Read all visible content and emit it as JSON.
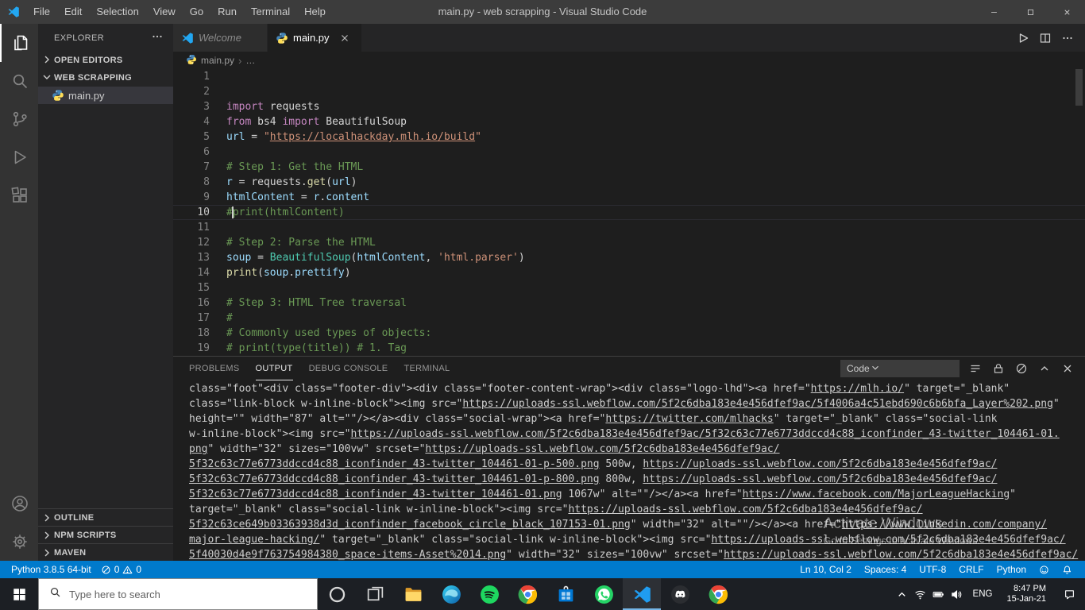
{
  "title_bar": {
    "logo_icon": "vscode-logo-icon",
    "menus": [
      "File",
      "Edit",
      "Selection",
      "View",
      "Go",
      "Run",
      "Terminal",
      "Help"
    ],
    "title": "main.py - web scrapping - Visual Studio Code",
    "window_controls": [
      "minimize-icon",
      "maximize-icon",
      "close-icon"
    ]
  },
  "activity_bar": {
    "top": [
      {
        "icon": "files-icon",
        "active": true
      },
      {
        "icon": "search-icon"
      },
      {
        "icon": "source-control-icon"
      },
      {
        "icon": "run-debug-icon"
      },
      {
        "icon": "extensions-icon"
      }
    ],
    "bottom": [
      {
        "icon": "account-icon"
      },
      {
        "icon": "settings-gear-icon"
      }
    ]
  },
  "sidebar": {
    "title": "EXPLORER",
    "actions_icon": "more-icon",
    "open_editors_label": "OPEN EDITORS",
    "open_editors_chevron": "chevron-right-icon",
    "folder_label": "WEB SCRAPPING",
    "folder_chevron": "chevron-down-icon",
    "files": [
      {
        "name": "main.py",
        "icon": "python-icon",
        "selected": true
      }
    ],
    "bottom_sections": [
      "OUTLINE",
      "NPM SCRIPTS",
      "MAVEN"
    ]
  },
  "editor": {
    "tabs": [
      {
        "label": "Welcome",
        "icon": "vscode-logo-icon",
        "active": false,
        "italic": true,
        "closable": false
      },
      {
        "label": "main.py",
        "icon": "python-icon",
        "active": true,
        "italic": false,
        "closable": true
      }
    ],
    "actions": [
      "play-icon",
      "split-editor-icon",
      "more-icon"
    ],
    "breadcrumb": {
      "icon": "python-icon",
      "file": "main.py",
      "separator": "›",
      "more": "…"
    },
    "lines": [
      {
        "n": 1,
        "segs": []
      },
      {
        "n": 2,
        "segs": []
      },
      {
        "n": 3,
        "segs": [
          [
            "k",
            "import"
          ],
          [
            "d",
            " requests"
          ]
        ]
      },
      {
        "n": 4,
        "segs": [
          [
            "k",
            "from"
          ],
          [
            "d",
            " bs4 "
          ],
          [
            "k",
            "import"
          ],
          [
            "d",
            " BeautifulSoup"
          ]
        ]
      },
      {
        "n": 5,
        "segs": [
          [
            "v",
            "url"
          ],
          [
            "d",
            " = "
          ],
          [
            "s",
            "\""
          ],
          [
            "su",
            "https://localhackday.mlh.io/build"
          ],
          [
            "s",
            "\""
          ]
        ]
      },
      {
        "n": 6,
        "segs": []
      },
      {
        "n": 7,
        "segs": [
          [
            "c",
            "# Step 1: Get the HTML"
          ]
        ]
      },
      {
        "n": 8,
        "segs": [
          [
            "v",
            "r"
          ],
          [
            "d",
            " = "
          ],
          [
            "d",
            "requests."
          ],
          [
            "f",
            "get"
          ],
          [
            "d",
            "("
          ],
          [
            "v",
            "url"
          ],
          [
            "d",
            ")"
          ]
        ]
      },
      {
        "n": 9,
        "segs": [
          [
            "v",
            "htmlContent"
          ],
          [
            "d",
            " = "
          ],
          [
            "v",
            "r"
          ],
          [
            "d",
            "."
          ],
          [
            "v",
            "content"
          ]
        ]
      },
      {
        "n": 10,
        "current": true,
        "segs": [
          [
            "c",
            "#"
          ],
          [
            "cursor",
            ""
          ],
          [
            "c",
            "print(htmlContent)"
          ]
        ]
      },
      {
        "n": 11,
        "segs": []
      },
      {
        "n": 12,
        "segs": [
          [
            "c",
            "# Step 2: Parse the HTML"
          ]
        ]
      },
      {
        "n": 13,
        "segs": [
          [
            "v",
            "soup"
          ],
          [
            "d",
            " = "
          ],
          [
            "t",
            "BeautifulSoup"
          ],
          [
            "d",
            "("
          ],
          [
            "v",
            "htmlContent"
          ],
          [
            "d",
            ", "
          ],
          [
            "s",
            "'html.parser'"
          ],
          [
            "d",
            ")"
          ]
        ]
      },
      {
        "n": 14,
        "segs": [
          [
            "f",
            "print"
          ],
          [
            "d",
            "("
          ],
          [
            "v",
            "soup"
          ],
          [
            "d",
            "."
          ],
          [
            "v",
            "prettify"
          ],
          [
            "d",
            ")"
          ]
        ]
      },
      {
        "n": 15,
        "segs": []
      },
      {
        "n": 16,
        "segs": [
          [
            "c",
            "# Step 3: HTML Tree traversal"
          ]
        ]
      },
      {
        "n": 17,
        "segs": [
          [
            "c",
            "#"
          ]
        ]
      },
      {
        "n": 18,
        "segs": [
          [
            "c",
            "# Commonly used types of objects:"
          ]
        ]
      },
      {
        "n": 19,
        "segs": [
          [
            "c",
            "# print(type(title)) # 1. Tag"
          ]
        ]
      }
    ]
  },
  "panel": {
    "tabs": [
      {
        "label": "PROBLEMS"
      },
      {
        "label": "OUTPUT",
        "active": true
      },
      {
        "label": "DEBUG CONSOLE"
      },
      {
        "label": "TERMINAL"
      }
    ],
    "channel": "Code",
    "channel_chevron": "chevron-down-icon",
    "actions": [
      "word-wrap-icon",
      "lock-icon",
      "clear-output-icon",
      "chevron-up-icon",
      "close-icon"
    ],
    "output_lines": [
      [
        [
          "d",
          "class=\"foot\"<div class=\"footer-div\"><div class=\"footer-content-wrap\"><div class=\"logo-lhd\"><a href=\""
        ],
        [
          "u",
          "https://mlh.io/"
        ],
        [
          "d",
          "\" target=\"_blank\""
        ]
      ],
      [
        [
          "d",
          "class=\"link-block w-inline-block\"><img src=\""
        ],
        [
          "u",
          "https://uploads-ssl.webflow.com/5f2c6dba183e4e456dfef9ac/5f4006a4c51ebd690c6b6bfa_Layer%202.png"
        ],
        [
          "d",
          "\""
        ]
      ],
      [
        [
          "d",
          "height=\"\" width=\"87\" alt=\"\"/></a><div class=\"social-wrap\"><a href=\""
        ],
        [
          "u",
          "https://twitter.com/mlhacks"
        ],
        [
          "d",
          "\" target=\"_blank\" class=\"social-link"
        ]
      ],
      [
        [
          "d",
          "w-inline-block\"><img src=\""
        ],
        [
          "u",
          "https://uploads-ssl.webflow.com/5f2c6dba183e4e456dfef9ac/5f32c63c77e6773ddccd4c88_iconfinder_43-twitter_104461-01."
        ]
      ],
      [
        [
          "u",
          "png"
        ],
        [
          "d",
          "\" width=\"32\" sizes=\"100vw\" srcset=\""
        ],
        [
          "u",
          "https://uploads-ssl.webflow.com/5f2c6dba183e4e456dfef9ac/"
        ]
      ],
      [
        [
          "u",
          "5f32c63c77e6773ddccd4c88_iconfinder_43-twitter_104461-01-p-500.png"
        ],
        [
          "d",
          " 500w, "
        ],
        [
          "u",
          "https://uploads-ssl.webflow.com/5f2c6dba183e4e456dfef9ac/"
        ]
      ],
      [
        [
          "u",
          "5f32c63c77e6773ddccd4c88_iconfinder_43-twitter_104461-01-p-800.png"
        ],
        [
          "d",
          " 800w, "
        ],
        [
          "u",
          "https://uploads-ssl.webflow.com/5f2c6dba183e4e456dfef9ac/"
        ]
      ],
      [
        [
          "u",
          "5f32c63c77e6773ddccd4c88_iconfinder_43-twitter_104461-01.png"
        ],
        [
          "d",
          " 1067w\" alt=\"\"/></a><a href=\""
        ],
        [
          "u",
          "https://www.facebook.com/MajorLeagueHacking"
        ],
        [
          "d",
          "\""
        ]
      ],
      [
        [
          "d",
          "target=\"_blank\" class=\"social-link w-inline-block\"><img src=\""
        ],
        [
          "u",
          "https://uploads-ssl.webflow.com/5f2c6dba183e4e456dfef9ac/"
        ]
      ],
      [
        [
          "u",
          "5f32c63ce649b03363938d3d_iconfinder_facebook_circle_black_107153-01.png"
        ],
        [
          "d",
          "\" width=\"32\" alt=\"\"/></a><a href=\""
        ],
        [
          "u",
          "https://www.linkedin.com/company/"
        ]
      ],
      [
        [
          "u",
          "major-league-hacking/"
        ],
        [
          "d",
          "\" target=\"_blank\" class=\"social-link w-inline-block\"><img src=\""
        ],
        [
          "u",
          "https://uploads-ssl.webflow.com/5f2c6dba183e4e456dfef9ac/"
        ]
      ],
      [
        [
          "u",
          "5f40030d4e9f763754984380_space-items-Asset%2014.png"
        ],
        [
          "d",
          "\" width=\"32\" sizes=\"100vw\" srcset=\""
        ],
        [
          "u",
          "https://uploads-ssl.webflow.com/5f2c6dba183e4e456dfef9ac/"
        ]
      ]
    ]
  },
  "status_bar": {
    "interpreter": "Python 3.8.5 64-bit",
    "errors": "0",
    "warnings": "0",
    "right": [
      {
        "label": "Ln 10, Col 2"
      },
      {
        "label": "Spaces: 4"
      },
      {
        "label": "UTF-8"
      },
      {
        "label": "CRLF"
      },
      {
        "label": "Python"
      },
      {
        "icon": "feedback-smiley-icon"
      },
      {
        "icon": "bell-icon"
      }
    ]
  },
  "watermark": {
    "line1": "Activate Windows",
    "line2": "Go to Settings to activate Windows."
  },
  "taskbar": {
    "start_icon": "windows-start-icon",
    "search": {
      "icon": "magnifier-icon",
      "placeholder": "Type here to search"
    },
    "apps": [
      {
        "icon": "cortana-icon"
      },
      {
        "icon": "task-view-icon"
      },
      {
        "icon": "file-explorer-icon"
      },
      {
        "icon": "edge-icon"
      },
      {
        "icon": "spotify-icon"
      },
      {
        "icon": "chrome-icon"
      },
      {
        "icon": "microsoft-store-icon"
      },
      {
        "icon": "whatsapp-icon"
      },
      {
        "icon": "vscode-icon",
        "active": true
      },
      {
        "icon": "discord-icon"
      },
      {
        "icon": "chrome-2-icon"
      }
    ],
    "tray": {
      "icons": [
        "tray-chevron-icon",
        "wifi-icon",
        "battery-icon",
        "volume-icon"
      ],
      "lang": "ENG",
      "time": "8:47 PM",
      "date": "15-Jan-21",
      "notification_icon": "notification-icon"
    }
  }
}
